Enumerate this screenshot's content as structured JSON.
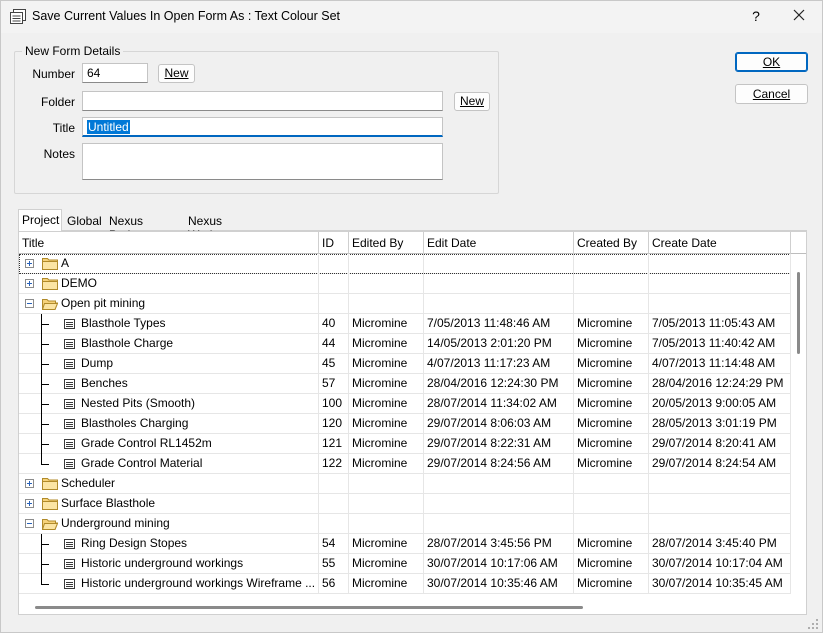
{
  "window": {
    "title": "Save Current Values In Open Form As : Text Colour Set",
    "help_label": "?"
  },
  "form": {
    "group_label": "New Form Details",
    "number_label": "Number",
    "number_value": "64",
    "number_new_label": "New",
    "folder_label": "Folder",
    "folder_value": "",
    "folder_new_label": "New",
    "title_label": "Title",
    "title_value": "Untitled",
    "notes_label": "Notes",
    "notes_value": ""
  },
  "actions": {
    "ok_label": "OK",
    "cancel_label": "Cancel"
  },
  "tabs": [
    "Project",
    "Global",
    "Nexus Project",
    "Nexus Workspace"
  ],
  "grid": {
    "columns": [
      "Title",
      "ID",
      "Edited By",
      "Edit Date",
      "Created By",
      "Create Date"
    ],
    "rows": [
      {
        "kind": "folder",
        "expanded": false,
        "title": "A"
      },
      {
        "kind": "folder",
        "expanded": false,
        "title": "DEMO"
      },
      {
        "kind": "folder",
        "expanded": true,
        "title": "Open pit mining"
      },
      {
        "kind": "form",
        "title": "Blasthole Types",
        "id": "40",
        "edited_by": "Micromine",
        "edit_date": "7/05/2013 11:48:46 AM",
        "created_by": "Micromine",
        "create_date": "7/05/2013 11:05:43 AM"
      },
      {
        "kind": "form",
        "title": "Blasthole Charge",
        "id": "44",
        "edited_by": "Micromine",
        "edit_date": "14/05/2013 2:01:20 PM",
        "created_by": "Micromine",
        "create_date": "7/05/2013 11:40:42 AM"
      },
      {
        "kind": "form",
        "title": "Dump",
        "id": "45",
        "edited_by": "Micromine",
        "edit_date": "4/07/2013 11:17:23 AM",
        "created_by": "Micromine",
        "create_date": "4/07/2013 11:14:48 AM"
      },
      {
        "kind": "form",
        "title": "Benches",
        "id": "57",
        "edited_by": "Micromine",
        "edit_date": "28/04/2016 12:24:30 PM",
        "created_by": "Micromine",
        "create_date": "28/04/2016 12:24:29 PM"
      },
      {
        "kind": "form",
        "title": "Nested Pits (Smooth)",
        "id": "100",
        "edited_by": "Micromine",
        "edit_date": "28/07/2014 11:34:02 AM",
        "created_by": "Micromine",
        "create_date": "20/05/2013 9:00:05 AM"
      },
      {
        "kind": "form",
        "title": "Blastholes Charging",
        "id": "120",
        "edited_by": "Micromine",
        "edit_date": "29/07/2014 8:06:03 AM",
        "created_by": "Micromine",
        "create_date": "28/05/2013 3:01:19 PM"
      },
      {
        "kind": "form",
        "title": "Grade Control RL1452m",
        "id": "121",
        "edited_by": "Micromine",
        "edit_date": "29/07/2014 8:22:31 AM",
        "created_by": "Micromine",
        "create_date": "29/07/2014 8:20:41 AM"
      },
      {
        "kind": "form",
        "last": true,
        "title": "Grade Control Material",
        "id": "122",
        "edited_by": "Micromine",
        "edit_date": "29/07/2014 8:24:56 AM",
        "created_by": "Micromine",
        "create_date": "29/07/2014 8:24:54 AM"
      },
      {
        "kind": "folder",
        "expanded": false,
        "title": "Scheduler"
      },
      {
        "kind": "folder",
        "expanded": false,
        "title": "Surface Blasthole"
      },
      {
        "kind": "folder",
        "expanded": true,
        "title": "Underground mining"
      },
      {
        "kind": "form",
        "title": "Ring Design Stopes",
        "id": "54",
        "edited_by": "Micromine",
        "edit_date": "28/07/2014 3:45:56 PM",
        "created_by": "Micromine",
        "create_date": "28/07/2014 3:45:40 PM"
      },
      {
        "kind": "form",
        "title": "Historic underground workings",
        "id": "55",
        "edited_by": "Micromine",
        "edit_date": "30/07/2014 10:17:06 AM",
        "created_by": "Micromine",
        "create_date": "30/07/2014 10:17:04 AM"
      },
      {
        "kind": "form",
        "last": true,
        "title": "Historic underground workings Wireframe ...",
        "id": "56",
        "edited_by": "Micromine",
        "edit_date": "30/07/2014 10:35:46 AM",
        "created_by": "Micromine",
        "create_date": "30/07/2014 10:35:45 AM"
      }
    ]
  }
}
